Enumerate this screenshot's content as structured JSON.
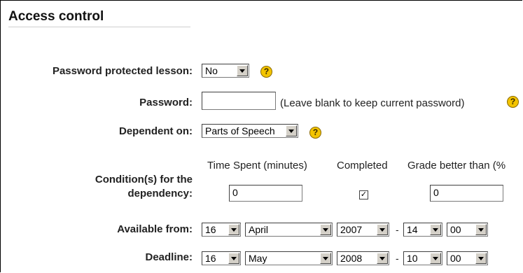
{
  "section": {
    "title": "Access control"
  },
  "password_protected": {
    "label": "Password protected lesson:",
    "value": "No"
  },
  "password": {
    "label": "Password:",
    "value": "",
    "hint": "(Leave blank to keep current password)"
  },
  "dependent_on": {
    "label": "Dependent on:",
    "value": "Parts of Speech"
  },
  "conditions": {
    "label_line1": "Condition(s) for the",
    "label_line2": "dependency:",
    "col_time": "Time Spent (minutes)",
    "col_completed": "Completed",
    "col_grade": "Grade better than (%",
    "time_value": "0",
    "completed_checked": "✓",
    "grade_value": "0"
  },
  "available_from": {
    "label": "Available from:",
    "day": "16",
    "month": "April",
    "year": "2007",
    "hour": "14",
    "minute": "00",
    "separator": "-"
  },
  "deadline": {
    "label": "Deadline:",
    "day": "16",
    "month": "May",
    "year": "2008",
    "hour": "10",
    "minute": "00",
    "separator": "-"
  },
  "help_icon": {
    "glyph": "?"
  },
  "colors": {
    "help_icon": "#f3c400"
  }
}
